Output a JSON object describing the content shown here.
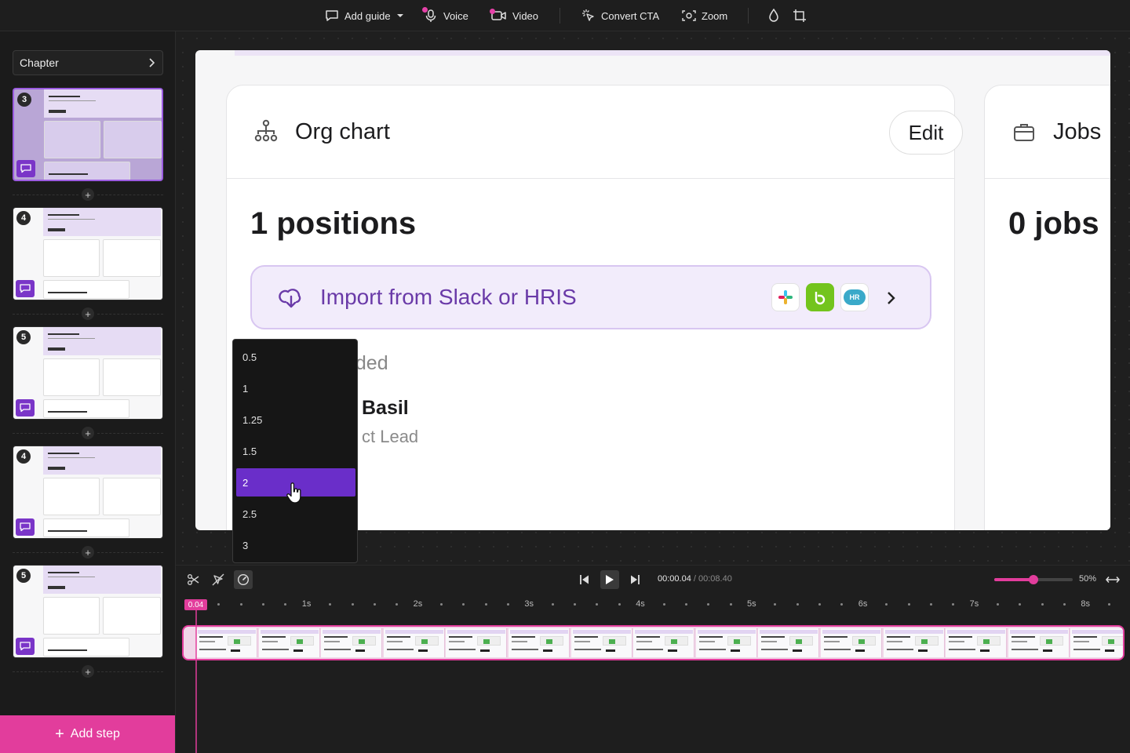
{
  "toolbar": {
    "add_guide": "Add guide",
    "voice": "Voice",
    "video": "Video",
    "convert_cta": "Convert CTA",
    "zoom": "Zoom"
  },
  "sidebar": {
    "chapter_label": "Chapter",
    "steps": [
      {
        "number": "3",
        "active": true
      },
      {
        "number": "4",
        "active": false
      },
      {
        "number": "5",
        "active": false
      },
      {
        "number": "4",
        "active": false
      },
      {
        "number": "5",
        "active": false
      }
    ],
    "add_step_label": "Add step"
  },
  "preview": {
    "org_card": {
      "title": "Org chart",
      "edit_label": "Edit",
      "positions": "1 positions",
      "import_label": "Import from Slack or HRIS",
      "added_fragment": "dded",
      "person_name": "Basil",
      "person_role_fragment": "ct Lead",
      "logo_hr": "HR"
    },
    "jobs_card": {
      "title": "Jobs",
      "count": "0 jobs"
    }
  },
  "speed_menu": {
    "options": [
      "0.5",
      "1",
      "1.25",
      "1.5",
      "2",
      "2.5",
      "3"
    ],
    "selected": "2"
  },
  "timeline": {
    "current_time": "00:00.04",
    "total_time": " / 00:08.40",
    "zoom_label": "50%",
    "zoom_level": 0.5,
    "playhead_label": "0.04",
    "ruler_labels": [
      "1s",
      "2s",
      "3s",
      "4s",
      "5s",
      "6s",
      "7s",
      "8s"
    ]
  },
  "colors": {
    "accent": "#e23d9c",
    "selected_option": "#6a2ec9",
    "import_text": "#6a3aa8"
  }
}
